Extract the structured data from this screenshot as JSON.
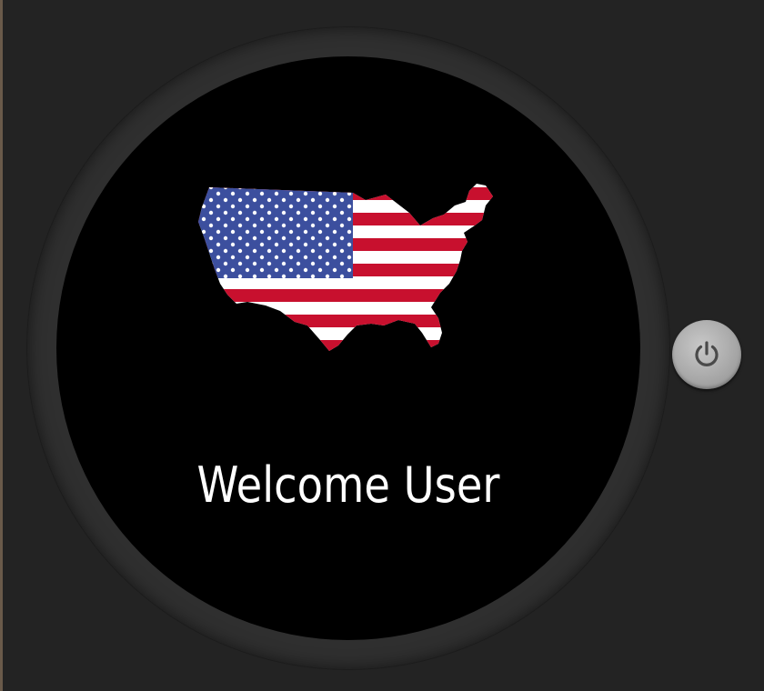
{
  "screen": {
    "welcome_text": "Welcome User",
    "background_color": "#000000"
  },
  "device": {
    "bezel_color": "#2f2f2f",
    "frame_color": "#232323",
    "power_button_icon": "power-icon"
  },
  "flag_map": {
    "icon": "usa-flag-map-icon",
    "colors": {
      "blue": "#3c4f9e",
      "red": "#c8102e",
      "white": "#ffffff"
    }
  }
}
